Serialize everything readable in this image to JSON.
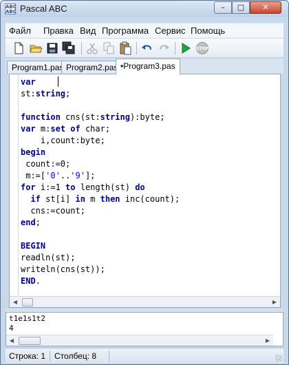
{
  "window": {
    "title": "Pascal ABC",
    "icon_text": [
      "ABC",
      "ABC"
    ],
    "controls": {
      "minimize": "minimize-icon",
      "maximize": "maximize-icon",
      "close": "close-icon"
    }
  },
  "menu": {
    "items": [
      "Файл",
      "Правка",
      "Вид",
      "Программа",
      "Сервис",
      "Помощь"
    ]
  },
  "toolbar": {
    "buttons": [
      "new-file-icon",
      "open-folder-icon",
      "save-icon",
      "save-all-icon",
      "cut-icon",
      "copy-icon",
      "paste-icon",
      "undo-icon",
      "redo-icon",
      "run-icon",
      "stop-icon"
    ],
    "stop_label": "STOP"
  },
  "tabs": [
    {
      "label": "Program1.pas",
      "active": false
    },
    {
      "label": "Program2.pas",
      "active": false
    },
    {
      "label": "•Program3.pas",
      "active": true
    }
  ],
  "editor": {
    "lines": [
      {
        "parts": [
          {
            "t": "var",
            "c": "kw"
          }
        ]
      },
      {
        "parts": [
          {
            "t": "st:",
            "c": ""
          },
          {
            "t": "string",
            "c": "kw"
          },
          {
            "t": ";",
            "c": ""
          }
        ]
      },
      {
        "parts": []
      },
      {
        "parts": [
          {
            "t": "function",
            "c": "kw"
          },
          {
            "t": " cns(st:",
            "c": ""
          },
          {
            "t": "string",
            "c": "kw"
          },
          {
            "t": "):byte;",
            "c": ""
          }
        ]
      },
      {
        "parts": [
          {
            "t": "var",
            "c": "kw"
          },
          {
            "t": " m:",
            "c": ""
          },
          {
            "t": "set of",
            "c": "kw"
          },
          {
            "t": " char;",
            "c": ""
          }
        ]
      },
      {
        "parts": [
          {
            "t": "    i,count:byte;",
            "c": ""
          }
        ]
      },
      {
        "parts": [
          {
            "t": "begin",
            "c": "kw"
          }
        ]
      },
      {
        "parts": [
          {
            "t": " count:=0;",
            "c": ""
          }
        ]
      },
      {
        "parts": [
          {
            "t": " m:=[",
            "c": ""
          },
          {
            "t": "'0'",
            "c": "str"
          },
          {
            "t": "..",
            "c": ""
          },
          {
            "t": "'9'",
            "c": "str"
          },
          {
            "t": "];",
            "c": ""
          }
        ]
      },
      {
        "parts": [
          {
            "t": "for",
            "c": "kw"
          },
          {
            "t": " i:=1 ",
            "c": ""
          },
          {
            "t": "to",
            "c": "kw"
          },
          {
            "t": " length(st) ",
            "c": ""
          },
          {
            "t": "do",
            "c": "kw"
          }
        ]
      },
      {
        "parts": [
          {
            "t": "  ",
            "c": ""
          },
          {
            "t": "if",
            "c": "kw"
          },
          {
            "t": " st[i] ",
            "c": ""
          },
          {
            "t": "in",
            "c": "kw"
          },
          {
            "t": " m ",
            "c": ""
          },
          {
            "t": "then",
            "c": "kw"
          },
          {
            "t": " inc(count);",
            "c": ""
          }
        ]
      },
      {
        "parts": [
          {
            "t": "  cns:=count;",
            "c": ""
          }
        ]
      },
      {
        "parts": [
          {
            "t": "end",
            "c": "kw"
          },
          {
            "t": ";",
            "c": ""
          }
        ]
      },
      {
        "parts": []
      },
      {
        "parts": [
          {
            "t": "BEGIN",
            "c": "kw"
          }
        ]
      },
      {
        "parts": [
          {
            "t": "readln(st);",
            "c": ""
          }
        ]
      },
      {
        "parts": [
          {
            "t": "writeln(cns(st));",
            "c": ""
          }
        ]
      },
      {
        "parts": [
          {
            "t": "END",
            "c": "kw"
          },
          {
            "t": ".",
            "c": ""
          }
        ]
      }
    ]
  },
  "output": {
    "lines": [
      "t1e1s1t2",
      "4"
    ]
  },
  "status": {
    "line": "Строка: 1",
    "column": "Столбец: 8"
  },
  "colors": {
    "keyword": "#00008b",
    "string": "#0000ff",
    "frame": "#c9d9ec"
  }
}
